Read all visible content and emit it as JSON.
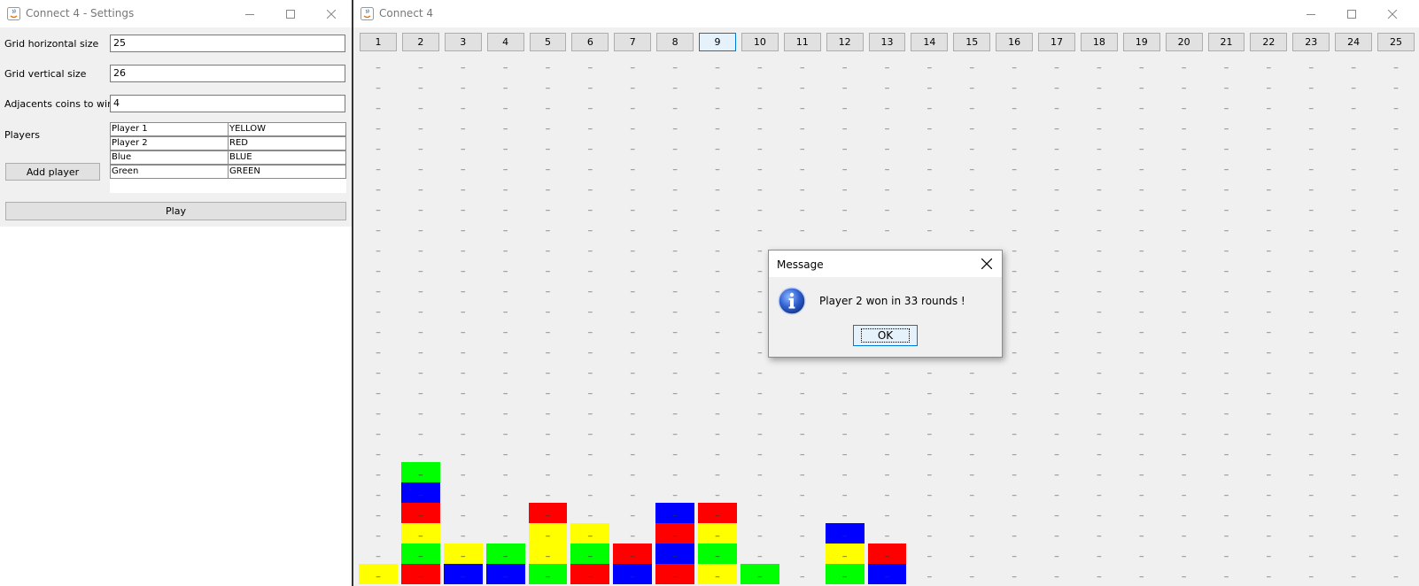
{
  "settings_window": {
    "title": "Connect 4 - Settings",
    "fields": [
      {
        "label": "Grid horizontal size",
        "value": "25"
      },
      {
        "label": "Grid vertical size",
        "value": "26"
      },
      {
        "label": "Adjacents coins to win",
        "value": "4"
      }
    ],
    "players_label": "Players",
    "players": [
      {
        "name": "Player 1",
        "color": "YELLOW"
      },
      {
        "name": "Player 2",
        "color": "RED"
      },
      {
        "name": "Blue",
        "color": "BLUE"
      },
      {
        "name": "Green",
        "color": "GREEN"
      }
    ],
    "add_player_label": "Add player",
    "play_label": "Play"
  },
  "game_window": {
    "title": "Connect 4",
    "column_labels": [
      "1",
      "2",
      "3",
      "4",
      "5",
      "6",
      "7",
      "8",
      "9",
      "10",
      "11",
      "12",
      "13",
      "14",
      "15",
      "16",
      "17",
      "18",
      "19",
      "20",
      "21",
      "22",
      "23",
      "24",
      "25"
    ],
    "focused_column": 9,
    "rows": 26,
    "empty_symbol": "_",
    "columns_bottom_up": {
      "1": [
        "Y"
      ],
      "2": [
        "R",
        "G",
        "Y",
        "R",
        "B",
        "G"
      ],
      "3": [
        "B",
        "Y"
      ],
      "4": [
        "B",
        "G"
      ],
      "5": [
        "G",
        "Y",
        "Y",
        "R"
      ],
      "6": [
        "R",
        "G",
        "Y"
      ],
      "7": [
        "B",
        "R"
      ],
      "8": [
        "R",
        "B",
        "R",
        "B"
      ],
      "9": [
        "Y",
        "G",
        "Y",
        "R"
      ],
      "10": [
        "G"
      ],
      "12": [
        "G",
        "Y",
        "B"
      ],
      "13": [
        "B",
        "R"
      ]
    }
  },
  "dialog": {
    "title": "Message",
    "message": "Player 2 won in 33 rounds !",
    "ok_label": "OK"
  },
  "colors": {
    "Y": "#ffff00",
    "R": "#ff0000",
    "G": "#00ff00",
    "B": "#0000ff"
  }
}
